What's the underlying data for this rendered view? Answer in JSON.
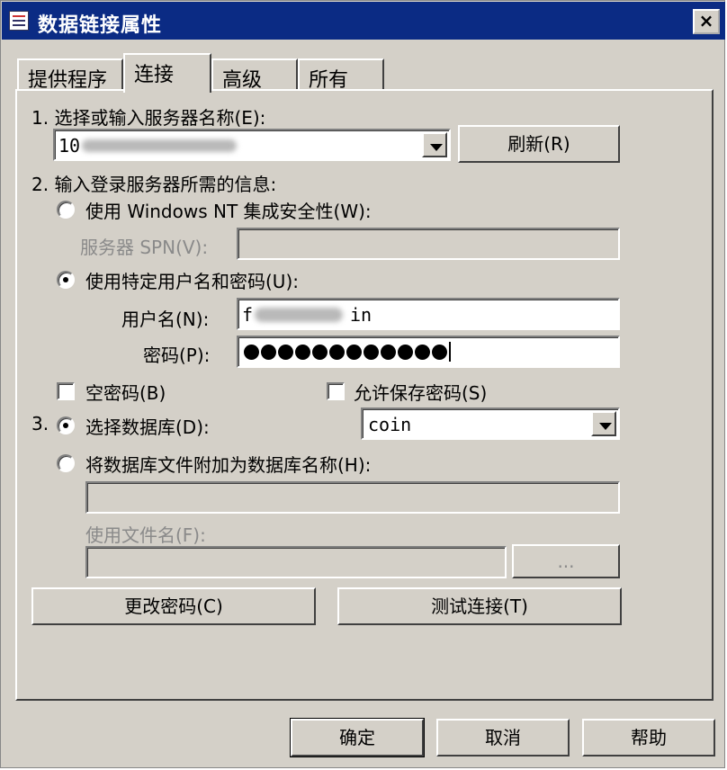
{
  "window": {
    "title": "数据链接属性",
    "close_glyph": "×"
  },
  "tabs": [
    "提供程序",
    "连接",
    "高级",
    "所有"
  ],
  "step1": {
    "label": "1. 选择或输入服务器名称(E):",
    "server_value": "10",
    "refresh_label": "刷新(R)"
  },
  "step2": {
    "label": "2. 输入登录服务器所需的信息:",
    "option_windows": "使用 Windows NT 集成安全性(W):",
    "spn_label": "服务器 SPN(V):",
    "option_specific": "使用特定用户名和密码(U):",
    "username_label": "用户名(N):",
    "username_prefix": "f",
    "username_suffix": "in",
    "password_label": "密码(P):",
    "password_length": 12,
    "blank_password": "空密码(B)",
    "allow_saving": "允许保存密码(S)"
  },
  "step3": {
    "number": "3.",
    "option_select_db": "选择数据库(D):",
    "database_value": "coin",
    "option_attach": "将数据库文件附加为数据库名称(H):",
    "filename_label": "使用文件名(F):",
    "browse_label": "..."
  },
  "actions": {
    "change_password": "更改密码(C)",
    "test_connection": "测试连接(T)"
  },
  "footer": {
    "ok": "确定",
    "cancel": "取消",
    "help": "帮助"
  }
}
